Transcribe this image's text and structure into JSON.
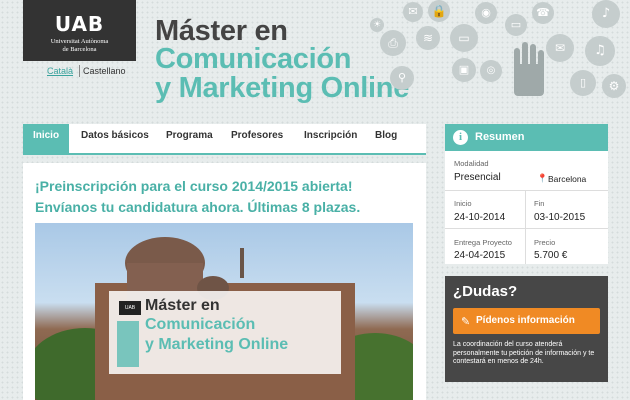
{
  "header": {
    "logo": {
      "name": "UAB",
      "sub": [
        "Universitat Autònoma",
        "de Barcelona"
      ]
    },
    "languages": [
      {
        "label": "Català",
        "active": true
      },
      {
        "label": "Castellano",
        "active": false
      }
    ],
    "title": [
      "Máster en",
      "Comunicación",
      "y Marketing Online"
    ],
    "icons": [
      "sun-icon",
      "email-icon",
      "lock-icon",
      "camera-icon",
      "monitor-icon",
      "phone-icon",
      "microphone-icon",
      "printer-icon",
      "wifi-icon",
      "laptop-icon",
      "image-icon",
      "message-icon",
      "headphones-icon",
      "rss-icon",
      "search-icon",
      "tablet-icon",
      "gear-icon"
    ]
  },
  "nav": {
    "items": [
      {
        "label": "Inicio",
        "active": true
      },
      {
        "label": "Datos básicos",
        "active": false
      },
      {
        "label": "Programa",
        "active": false
      },
      {
        "label": "Profesores",
        "active": false
      },
      {
        "label": "Inscripción",
        "active": false
      },
      {
        "label": "Blog",
        "active": false
      }
    ]
  },
  "main": {
    "headline": "¡Preinscripción para el curso 2014/2015 abierta! Envíanos tu candidatura ahora. Últimas 8 plazas.",
    "banner": {
      "logo": "UAB",
      "title": [
        "Máster en",
        "Comunicación",
        "y Marketing Online"
      ]
    }
  },
  "summary": {
    "title": "Resumen",
    "modalidad_label": "Modalidad",
    "modalidad_value": "Presencial",
    "location": "Barcelona",
    "inicio_label": "Inicio",
    "inicio_value": "24-10-2014",
    "fin_label": "Fin",
    "fin_value": "03-10-2015",
    "entrega_label": "Entrega Proyecto",
    "entrega_value": "24-04-2015",
    "precio_label": "Precio",
    "precio_value": "5.700 €"
  },
  "dudas": {
    "title": "¿Dudas?",
    "button_label": "Pídenos información",
    "text": "La coordinación del curso atenderá personalmente tu petición de información y te contestará en menos de 24h."
  },
  "colors": {
    "accent": "#5bbdb3",
    "dark": "#474747",
    "orange": "#f08a24"
  }
}
